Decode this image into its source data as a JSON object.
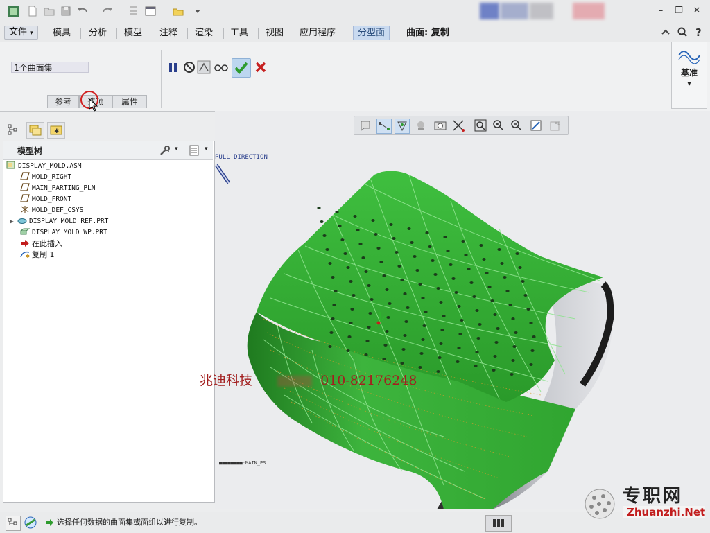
{
  "quick_access": {
    "icons": [
      "app-icon",
      "new-icon",
      "open-icon",
      "save-icon",
      "undo-icon",
      "redo-icon",
      "regenerate-icon",
      "window-icon",
      "folder-icon",
      "more-icon"
    ]
  },
  "window_controls": {
    "minimize": "–",
    "restore": "❐",
    "close": "✕"
  },
  "tabs": {
    "file": "文件",
    "file_arrow": "▾",
    "items": [
      "模具",
      "分析",
      "模型",
      "注释",
      "渲染",
      "工具",
      "视图",
      "应用程序"
    ],
    "active": "分型面",
    "context_label": "曲面: 复制"
  },
  "ribbon": {
    "collector_value": "1个曲面集",
    "subtabs": [
      "参考",
      "选项",
      "属性"
    ],
    "datum_label": "基准",
    "datum_arrow": "▾",
    "accent_ok": "#2e9b2e",
    "accent_cancel": "#c62020"
  },
  "model_tree": {
    "title": "模型树",
    "items": [
      {
        "label": "DISPLAY_MOLD.ASM",
        "icon": "assembly-icon"
      },
      {
        "label": "MOLD_RIGHT",
        "icon": "datum-plane-icon"
      },
      {
        "label": "MAIN_PARTING_PLN",
        "icon": "datum-plane-icon"
      },
      {
        "label": "MOLD_FRONT",
        "icon": "datum-plane-icon"
      },
      {
        "label": "MOLD_DEF_CSYS",
        "icon": "csys-icon"
      },
      {
        "label": "DISPLAY_MOLD_REF.PRT",
        "icon": "part-icon"
      },
      {
        "label": "DISPLAY_MOLD_WP.PRT",
        "icon": "workpiece-icon"
      },
      {
        "label": "在此插入",
        "icon": "insert-arrow-icon"
      },
      {
        "label": "复制 1",
        "icon": "copy-surface-icon"
      }
    ]
  },
  "viewport": {
    "pull_direction_label": "PULL DIRECTION",
    "plane_label": "MAIN_PS",
    "plane_prefix": "■■■■■■■■:",
    "watermark_company": "兆迪科技",
    "watermark_phone": "010-82176248",
    "model_color": "#33b533"
  },
  "status": {
    "message": "选择任何数据的曲面集或面组以进行复制。"
  },
  "site_logo": {
    "cn": "专职网",
    "en": "Zhuanzhi.Net"
  }
}
